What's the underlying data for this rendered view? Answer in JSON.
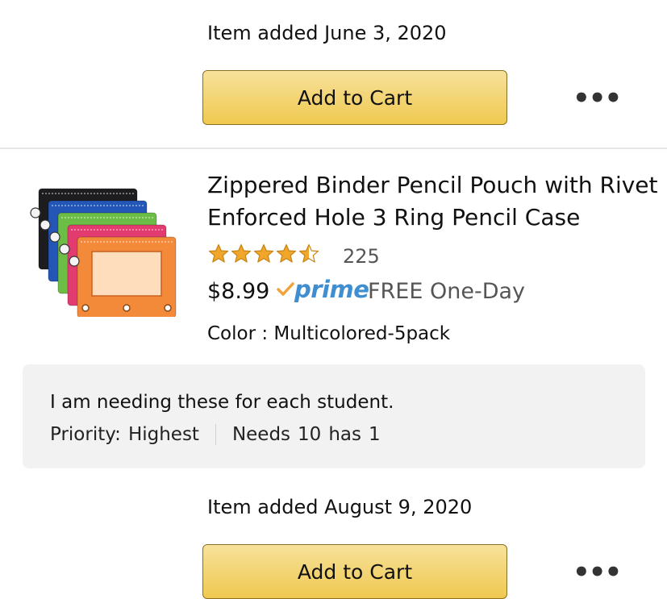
{
  "previous_item": {
    "added_label": "Item added June 3, 2020",
    "add_to_cart_label": "Add to Cart",
    "more_label": "•••"
  },
  "item": {
    "title": "Zippered Binder Pencil Pouch with Rivet Enforced Hole 3 Ring Pencil Case",
    "rating": 4.5,
    "rating_max": 5,
    "rating_count": "225",
    "price": "$8.99",
    "prime_label": "prime",
    "shipping": "FREE One-Day",
    "color_label": "Color : Multicolored-5pack",
    "comment": "I am needing these for each student.",
    "priority_label": "Priority:",
    "priority_value": "Highest",
    "needs_label": "Needs",
    "needs_value": "10",
    "has_label": "has",
    "has_value": "1",
    "pouch_colors": [
      "#1d1d1f",
      "#2456b8",
      "#6cbd45",
      "#e23b6f",
      "#f28a3a"
    ]
  },
  "next_item": {
    "added_label": "Item added August 9, 2020",
    "add_to_cart_label": "Add to Cart",
    "more_label": "•••"
  },
  "colors": {
    "button_top": "#f7e19b",
    "button_bottom": "#efc94f",
    "star": "#f0a52b",
    "prime_blue": "#3f8fd0",
    "prime_check": "#f2a33a"
  }
}
